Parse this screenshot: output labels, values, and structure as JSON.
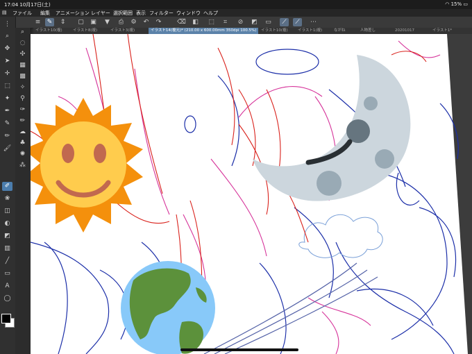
{
  "status": {
    "time_date": "17:04  10月17日(土)",
    "battery": "15%"
  },
  "menu": [
    "ファイル",
    "編集",
    "アニメーション",
    "レイヤー",
    "選択範囲",
    "表示",
    "フィルター",
    "ウィンドウ",
    "ヘルプ"
  ],
  "tabs": [
    "イラスト10(複)",
    "イラスト8(複)",
    "イラスト3(複)",
    "イラスト14(複元)* (210.00 x 600.00mm 350dpi 100.5%)",
    "イラスト10(複)",
    "イラスト1(複)",
    "ながね",
    "人物差し",
    "20201017",
    "イラスト1*"
  ],
  "active_tab_index": 3,
  "colors": {
    "toolbar": "#3a3a3a",
    "accent": "#4b7dad",
    "sketch_red": "#d9211b",
    "sketch_blue": "#1b2ea8",
    "sketch_pink": "#d6339a"
  },
  "emoji": {
    "sun": "sun-with-face",
    "moon": "last-quarter-moon-face",
    "earth": "earth-globe-americas"
  }
}
